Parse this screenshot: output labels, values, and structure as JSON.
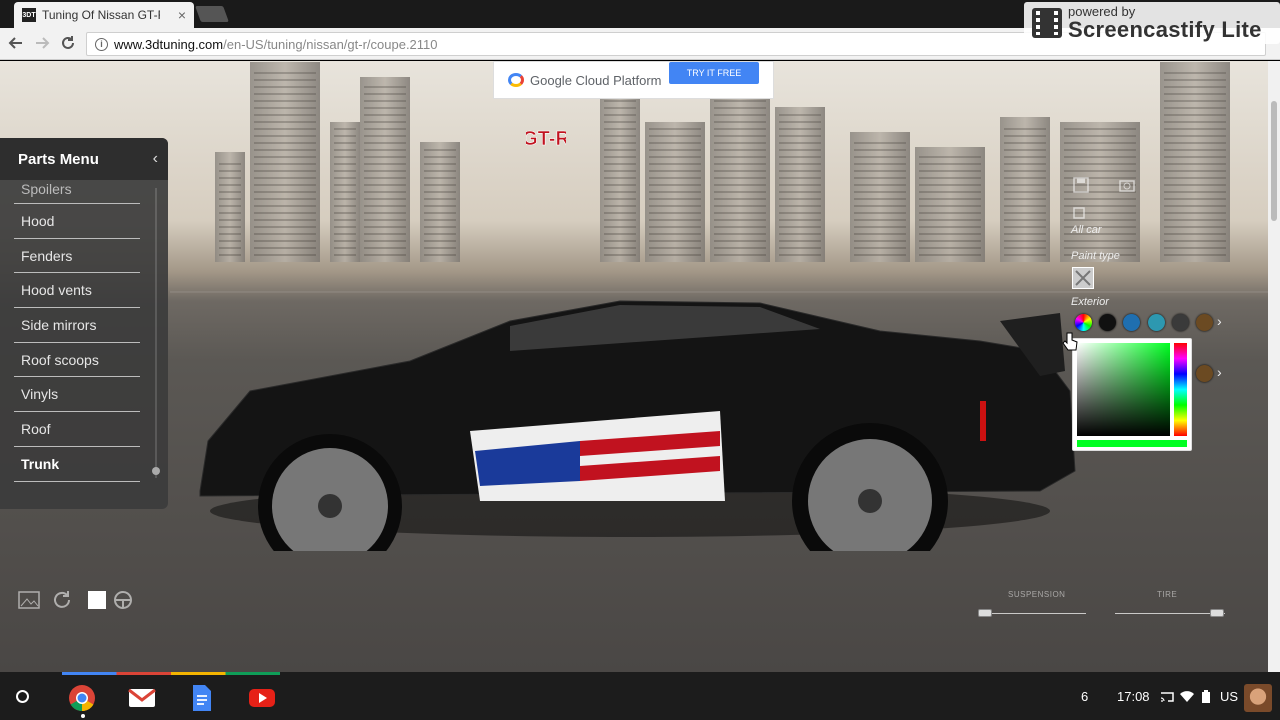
{
  "browser": {
    "tab_title": "Tuning Of Nissan GT-R C",
    "tab_favicon": "3DT",
    "tab_close": "×",
    "url_host": "www.3dtuning.com",
    "url_path": "/en-US/tuning/nissan/gt-r/coupe.2110"
  },
  "watermark": {
    "small": "powered by",
    "big": "Screencastify Lite"
  },
  "ad": {
    "text": "Google Cloud Platform",
    "button": "TRY IT FREE"
  },
  "brand_badge": "GT-R",
  "parts_menu": {
    "title": "Parts Menu",
    "collapse_icon": "‹",
    "items": [
      {
        "label": "Spoilers"
      },
      {
        "label": "Hood"
      },
      {
        "label": "Fenders"
      },
      {
        "label": "Hood vents"
      },
      {
        "label": "Side mirrors"
      },
      {
        "label": "Roof scoops"
      },
      {
        "label": "Vinyls"
      },
      {
        "label": "Roof"
      },
      {
        "label": "Trunk"
      }
    ],
    "active_item": "Trunk"
  },
  "right_panel": {
    "all_car_label": "All car",
    "paint_type_label": "Paint type",
    "exterior_label": "Exterior",
    "more_arrow": "›",
    "swatch_colors": [
      "#8a8a8a",
      "#111111",
      "#1f6fb0",
      "#2d98b0",
      "#3a3a3a",
      "#6b4a22"
    ],
    "picker_selected_color": "#00ff22"
  },
  "controls": {
    "suspension_label": "SUSPENSION",
    "tires_label": "TIRE",
    "suspension_value": 0.0,
    "tires_value": 1.0
  },
  "shelf": {
    "apps": [
      "chrome-icon",
      "gmail-icon",
      "docs-icon",
      "youtube-icon"
    ],
    "notifications": "6",
    "time": "17:08",
    "locale": "US"
  },
  "colors": {
    "menu_bg": "#3c3c3c",
    "ad_button": "#4285f4"
  }
}
